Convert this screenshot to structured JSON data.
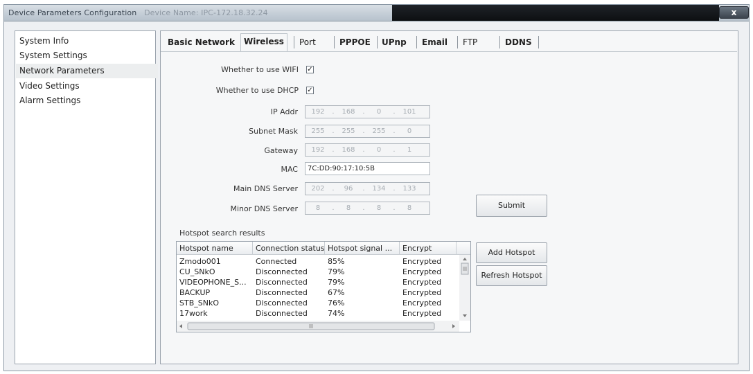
{
  "window": {
    "title": "Device Parameters Configuration",
    "device_name": "Device Name: IPC-172.18.32.24",
    "close_label": "x"
  },
  "sidebar": {
    "items": [
      {
        "label": "System Info"
      },
      {
        "label": "System Settings"
      },
      {
        "label": "Network Parameters"
      },
      {
        "label": "Video Settings"
      },
      {
        "label": "Alarm Settings"
      }
    ],
    "selected": "Network Parameters"
  },
  "tabs": [
    {
      "label": "Basic Network"
    },
    {
      "label": "Wireless"
    },
    {
      "label": "Port"
    },
    {
      "label": "PPPOE"
    },
    {
      "label": "UPnp"
    },
    {
      "label": "Email"
    },
    {
      "label": "FTP"
    },
    {
      "label": "DDNS"
    }
  ],
  "active_tab": "Wireless",
  "form": {
    "use_wifi_label": "Whether to use WIFI",
    "use_wifi_checked": true,
    "use_dhcp_label": "Whether to use DHCP",
    "use_dhcp_checked": true,
    "check_mark": "✓",
    "dot": ".",
    "ip_label": "IP Addr",
    "ip": [
      "192",
      "168",
      "0",
      "101"
    ],
    "mask_label": "Subnet Mask",
    "mask": [
      "255",
      "255",
      "255",
      "0"
    ],
    "gateway_label": "Gateway",
    "gateway": [
      "192",
      "168",
      "0",
      "1"
    ],
    "mac_label": "MAC",
    "mac": "7C:DD:90:17:10:5B",
    "main_dns_label": "Main DNS Server",
    "main_dns": [
      "202",
      "96",
      "134",
      "133"
    ],
    "minor_dns_label": "Minor DNS Server",
    "minor_dns": [
      "8",
      "8",
      "8",
      "8"
    ],
    "submit_label": "Submit"
  },
  "hotspot": {
    "section_label": "Hotspot search results",
    "columns": [
      "Hotspot name",
      "Connection status",
      "Hotspot signal ...",
      "Encrypt"
    ],
    "rows": [
      [
        "Zmodo001",
        "Connected",
        "85%",
        "Encrypted"
      ],
      [
        "CU_SNkO",
        "Disconnected",
        "79%",
        "Encrypted"
      ],
      [
        "VIDEOPHONE_S...",
        "Disconnected",
        "79%",
        "Encrypted"
      ],
      [
        "BACKUP",
        "Disconnected",
        "67%",
        "Encrypted"
      ],
      [
        "STB_SNkO",
        "Disconnected",
        "76%",
        "Encrypted"
      ],
      [
        "17work",
        "Disconnected",
        "74%",
        "Encrypted"
      ]
    ],
    "add_label": "Add Hotspot",
    "refresh_label": "Refresh Hotspot"
  }
}
